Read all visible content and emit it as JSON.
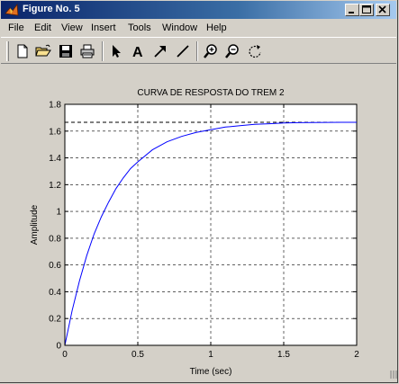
{
  "window": {
    "title": "Figure No. 5",
    "controls": [
      "minimize",
      "maximize",
      "close"
    ]
  },
  "menu": [
    "File",
    "Edit",
    "View",
    "Insert",
    "Tools",
    "Window",
    "Help"
  ],
  "toolbar": {
    "icons": [
      "new-file-icon",
      "open-folder-icon",
      "save-icon",
      "print-icon",
      "arrow-select-icon",
      "text-A-icon",
      "arrow-insert-icon",
      "line-insert-icon",
      "zoom-in-icon",
      "zoom-out-icon",
      "rotate-icon"
    ],
    "text_tool_label": "A"
  },
  "chart_data": {
    "type": "line",
    "title": "CURVA DE RESPOSTA DO TREM 2",
    "xlabel": "Time (sec)",
    "ylabel": "Amplitude",
    "xlim": [
      0,
      2
    ],
    "ylim": [
      0,
      1.8
    ],
    "xticks": [
      0,
      0.5,
      1,
      1.5,
      2
    ],
    "xtick_labels": [
      "0",
      "0.5",
      "1",
      "1.5",
      "2"
    ],
    "yticks": [
      0,
      0.2,
      0.4,
      0.6,
      0.8,
      1,
      1.2,
      1.4,
      1.6,
      1.8
    ],
    "ytick_labels": [
      "0",
      "0.2",
      "0.4",
      "0.6",
      "0.8",
      "1",
      "1.2",
      "1.4",
      "1.6",
      "1.8"
    ],
    "grid": true,
    "series": [
      {
        "color": "#0000ff",
        "x": [
          0,
          0.05,
          0.1,
          0.15,
          0.2,
          0.25,
          0.3,
          0.35,
          0.4,
          0.45,
          0.5,
          0.6,
          0.7,
          0.8,
          0.9,
          1.0,
          1.1,
          1.2,
          1.3,
          1.4,
          1.5,
          1.6,
          1.7,
          1.8,
          1.9,
          2.0
        ],
        "y": [
          0,
          0.26,
          0.48,
          0.67,
          0.83,
          0.96,
          1.07,
          1.17,
          1.25,
          1.32,
          1.37,
          1.46,
          1.52,
          1.56,
          1.59,
          1.61,
          1.63,
          1.64,
          1.65,
          1.655,
          1.66,
          1.663,
          1.664,
          1.665,
          1.666,
          1.666
        ]
      }
    ],
    "reference_line": {
      "y": 1.666,
      "style": "dashed",
      "color": "#000000"
    }
  }
}
